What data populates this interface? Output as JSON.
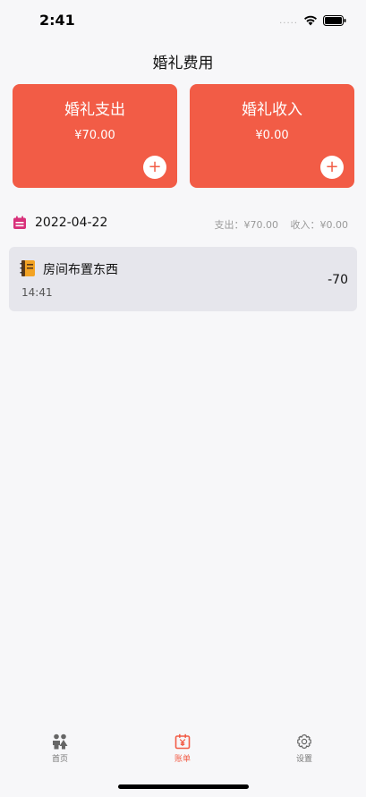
{
  "status": {
    "time": "2:41",
    "signal_dots": "....."
  },
  "header": {
    "title": "婚礼费用"
  },
  "cards": {
    "expense": {
      "title": "婚礼支出",
      "amount": "¥70.00",
      "add": "+"
    },
    "income": {
      "title": "婚礼收入",
      "amount": "¥0.00",
      "add": "+"
    }
  },
  "day": {
    "date": "2022-04-22",
    "expense_summary": "支出：¥70.00",
    "income_summary": "收入：¥0.00"
  },
  "records": [
    {
      "name": "房间布置东西",
      "time": "14:41",
      "amount": "-70",
      "icon": "notebook-icon"
    }
  ],
  "tabs": [
    {
      "label": "首页",
      "icon": "people-icon"
    },
    {
      "label": "账单",
      "icon": "calendar-yen-icon",
      "active": true
    },
    {
      "label": "设置",
      "icon": "gear-icon"
    }
  ],
  "colors": {
    "accent": "#f25c46",
    "record_bg": "#e6e6ec",
    "background": "#f7f7f9"
  }
}
